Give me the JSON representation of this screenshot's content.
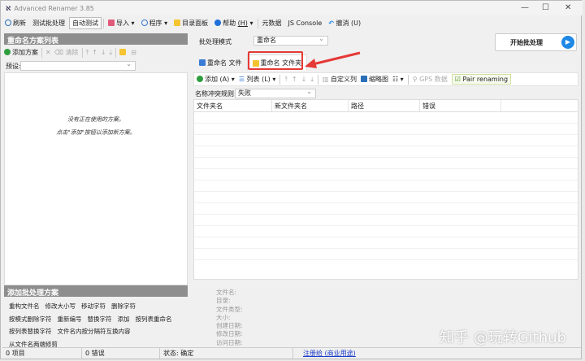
{
  "window": {
    "title": "Advanced Renamer 3.85"
  },
  "toolbar": {
    "refresh": "刷新",
    "test_batch": "测试批处理",
    "auto_test": "自动测试",
    "import": "导入",
    "program": "程序",
    "dir_panel": "目录面板",
    "help": "帮助",
    "help_key": "(H)",
    "metadata": "元数据",
    "js_console": "JS Console",
    "undo": "撤消 (U)"
  },
  "left": {
    "header": "重命名方案列表",
    "add_method": "添加方案",
    "clear": "清除",
    "preset_label": "预设:",
    "preset_value": "",
    "empty_msg1": "没有正在使用的方案。",
    "empty_msg2": "点击\"添加\"按钮以添加新方案。"
  },
  "batch": {
    "header": "添加批处理方案",
    "methods": [
      [
        "重构文件名",
        "修改大小写",
        "移动字符",
        "删除字符"
      ],
      [
        "按模式删除字符",
        "重新编号",
        "替换字符",
        "添加",
        "按列表重命名"
      ],
      [
        "按列表替换字符",
        "文件名内按分隔符互换内容"
      ],
      [
        "从文件名两端修剪"
      ]
    ]
  },
  "right": {
    "mode_label": "批处理模式",
    "mode_value": "重命名",
    "start": "开始批处理",
    "tabs": [
      {
        "label": "重命名 文件"
      },
      {
        "label": "重命名 文件夹"
      }
    ],
    "toolbar": {
      "add": "添加 (A)",
      "list": "列表 (L)",
      "custom_columns": "自定义列",
      "thumbnails": "缩略图",
      "gps": "GPS 数据",
      "pair": "Pair renaming"
    },
    "conflict_label": "名称冲突规则:",
    "conflict_value": "失败",
    "columns": [
      "文件夹名",
      "新文件夹名",
      "路径",
      "错误"
    ],
    "info": [
      "文件名:",
      "目录:",
      "文件类型:",
      "大小:",
      "创建日期:",
      "修改日期:",
      "访问日期:"
    ]
  },
  "status": {
    "items": "0 项目",
    "errors": "0 错误",
    "state": "状态: 确定",
    "register": "注册给 (商业用途)"
  },
  "watermark": "知乎 @玩转Github",
  "colors": {
    "accent": "#1e88e5",
    "highlight": "#e53935",
    "panel_header": "#8e8e8e"
  }
}
